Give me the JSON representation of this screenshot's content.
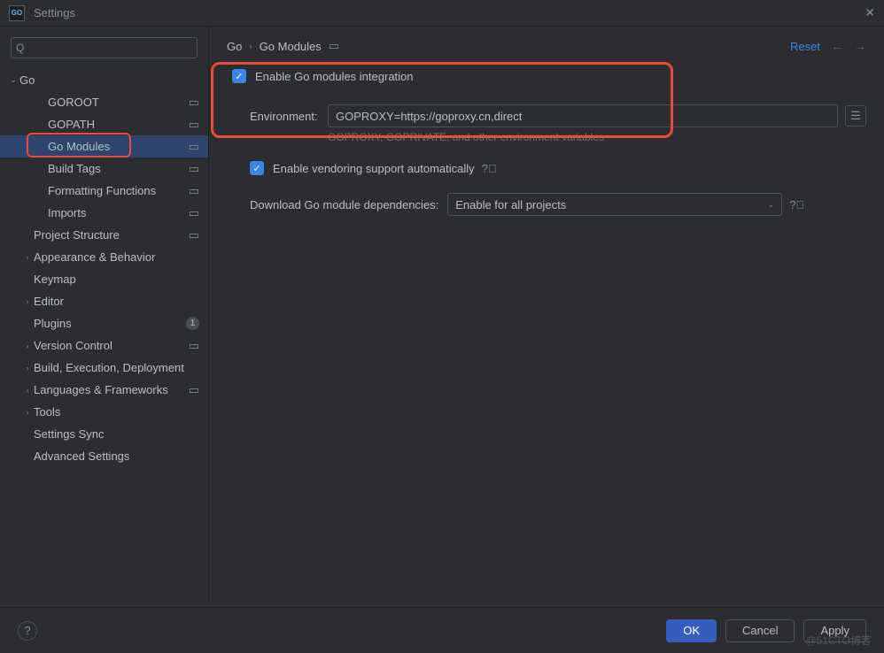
{
  "titlebar": {
    "app_icon": "GO",
    "title": "Settings"
  },
  "search": {
    "placeholder": ""
  },
  "sidebar": {
    "items": [
      {
        "label": "Go",
        "indent": 0,
        "arrow": "down",
        "square": false
      },
      {
        "label": "GOROOT",
        "indent": 2,
        "square": true
      },
      {
        "label": "GOPATH",
        "indent": 2,
        "square": true
      },
      {
        "label": "Go Modules",
        "indent": 2,
        "square": true,
        "selected": true,
        "highlighted": true
      },
      {
        "label": "Build Tags",
        "indent": 2,
        "square": true
      },
      {
        "label": "Formatting Functions",
        "indent": 2,
        "square": true
      },
      {
        "label": "Imports",
        "indent": 2,
        "square": true
      },
      {
        "label": "Project Structure",
        "indent": 1,
        "square": true
      },
      {
        "label": "Appearance & Behavior",
        "indent": 1,
        "arrow": "right"
      },
      {
        "label": "Keymap",
        "indent": 1
      },
      {
        "label": "Editor",
        "indent": 1,
        "arrow": "right"
      },
      {
        "label": "Plugins",
        "indent": 1,
        "badge": "1"
      },
      {
        "label": "Version Control",
        "indent": 1,
        "arrow": "right",
        "square": true
      },
      {
        "label": "Build, Execution, Deployment",
        "indent": 1,
        "arrow": "right"
      },
      {
        "label": "Languages & Frameworks",
        "indent": 1,
        "arrow": "right",
        "square": true
      },
      {
        "label": "Tools",
        "indent": 1,
        "arrow": "right"
      },
      {
        "label": "Settings Sync",
        "indent": 1
      },
      {
        "label": "Advanced Settings",
        "indent": 1
      }
    ]
  },
  "breadcrumb": {
    "root": "Go",
    "current": "Go Modules",
    "reset": "Reset"
  },
  "form": {
    "enable_integration": {
      "checked": true,
      "label": "Enable Go modules integration"
    },
    "environment": {
      "label": "Environment:",
      "value": "GOPROXY=https://goproxy.cn,direct",
      "hint": "GOPROXY, GOPRIVATE, and other environment variables"
    },
    "vendoring": {
      "checked": true,
      "label": "Enable vendoring support automatically"
    },
    "download": {
      "label": "Download Go module dependencies:",
      "value": "Enable for all projects"
    }
  },
  "footer": {
    "ok": "OK",
    "cancel": "Cancel",
    "apply": "Apply"
  },
  "watermark": "@51CTO博客"
}
